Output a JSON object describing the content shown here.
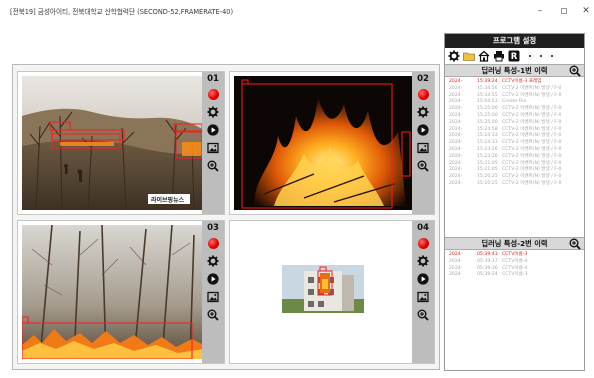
{
  "window": {
    "title": "[전북19] 금성아이티, 전북대학교 산학협력단   (SECOND-52,FRAMERATE-40)",
    "minimize_glyph": "–",
    "close_glyph": "✕"
  },
  "panels": [
    {
      "number": "01",
      "icons": [
        "record-icon",
        "settings-icon",
        "play-icon",
        "snapshot-icon",
        "zoom-in-icon"
      ],
      "watermark": "라이브핑뉴스"
    },
    {
      "number": "02",
      "icons": [
        "record-icon",
        "settings-icon",
        "play-icon",
        "snapshot-icon",
        "zoom-in-icon"
      ]
    },
    {
      "number": "03",
      "icons": [
        "record-icon",
        "settings-icon",
        "play-icon",
        "snapshot-icon",
        "zoom-in-icon"
      ]
    },
    {
      "number": "04",
      "icons": [
        "record-icon",
        "settings-icon",
        "play-icon",
        "snapshot-icon",
        "zoom-in-icon"
      ]
    }
  ],
  "settings": {
    "title": "프로그램 설정",
    "toolbar": [
      "gear-icon",
      "folder-icon",
      "home-icon",
      "print-icon",
      "r-icon",
      "more-dot",
      "more-dot",
      "more-dot"
    ],
    "section1": {
      "title": "딥러닝 특성-1번 이력",
      "rows": [
        {
          "date": "2024-",
          "time": "15:39:24",
          "msg": "CCTV이름-3 프레임",
          "active": true
        },
        {
          "date": "2024-",
          "time": "15:34:56",
          "msg": "CCTV-2 이벤트(N) 발생 / F-0",
          "active": false
        },
        {
          "date": "2024-",
          "time": "15:34:55",
          "msg": "CCTV-2 이벤트(N) 발생 / F-0",
          "active": false
        },
        {
          "date": "2024-",
          "time": "15:04:53",
          "msg": "Create File",
          "active": false
        },
        {
          "date": "2024-",
          "time": "15:25:00",
          "msg": "CCTV-2 이벤트(N) 발생 / F-0",
          "active": false
        },
        {
          "date": "2024-",
          "time": "15:25:00",
          "msg": "CCTV-2 이벤트(N) 발생 / F-0",
          "active": false
        },
        {
          "date": "2024-",
          "time": "15:25:00",
          "msg": "CCTV-2 이벤트(N) 발생 / F-0",
          "active": false
        },
        {
          "date": "2024-",
          "time": "15:24:58",
          "msg": "CCTV-2 이벤트(N) 발생 / F-0",
          "active": false
        },
        {
          "date": "2024-",
          "time": "15:24:33",
          "msg": "CCTV-2 이벤트(N) 발생 / F-0",
          "active": false
        },
        {
          "date": "2024-",
          "time": "15:24:33",
          "msg": "CCTV-2 이벤트(N) 발생 / F-0",
          "active": false
        },
        {
          "date": "2024-",
          "time": "15:23:26",
          "msg": "CCTV-2 이벤트(N) 발생 / F-0",
          "active": false
        },
        {
          "date": "2024-",
          "time": "15:23:26",
          "msg": "CCTV-2 이벤트(N) 발생 / F-0",
          "active": false
        },
        {
          "date": "2024-",
          "time": "15:21:05",
          "msg": "CCTV-2 이벤트(N) 발생 / F-0",
          "active": false
        },
        {
          "date": "2024-",
          "time": "15:21:05",
          "msg": "CCTV-2 이벤트(N) 발생 / F-0",
          "active": false
        },
        {
          "date": "2024-",
          "time": "15:20:25",
          "msg": "CCTV-2 이벤트(N) 발생 / F-0",
          "active": false
        },
        {
          "date": "2024-",
          "time": "15:20:25",
          "msg": "CCTV-2 이벤트(N) 발생 / F-0",
          "active": false
        }
      ]
    },
    "section2": {
      "title": "딥러닝 특성-2번 이력",
      "rows": [
        {
          "date": "2024-",
          "time": "05:39:43",
          "msg": "CCTV이름-3",
          "active": true
        },
        {
          "date": "2024-",
          "time": "05:39:37",
          "msg": "CCTV이름-4",
          "active": false
        },
        {
          "date": "2024-",
          "time": "05:39:36",
          "msg": "CCTV이름-4",
          "active": false
        },
        {
          "date": "2024-",
          "time": "05:39:24",
          "msg": "CCTV이름-3",
          "active": false
        }
      ]
    }
  },
  "colors": {
    "alert": "#e2231a",
    "header_dark": "#1f1f1f",
    "side_gray": "#bdbdbd"
  }
}
